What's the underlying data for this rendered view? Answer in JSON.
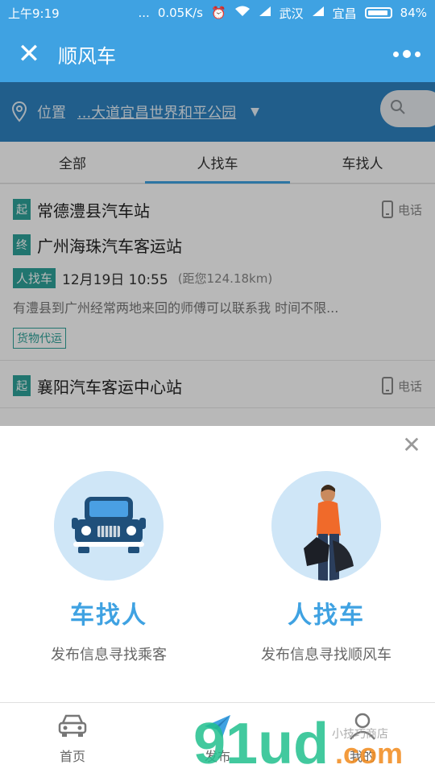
{
  "status_bar": {
    "time": "上午9:19",
    "dots": "...",
    "speed": "0.05K/s",
    "carrier1": "武汉",
    "carrier2": "宜昌",
    "battery": "84%"
  },
  "title_bar": {
    "title": "顺风车"
  },
  "location": {
    "label": "位置",
    "value": "...大道宜昌世界和平公园"
  },
  "tabs": [
    {
      "label": "全部",
      "active": false
    },
    {
      "label": "人找车",
      "active": true
    },
    {
      "label": "车找人",
      "active": false
    }
  ],
  "listings": [
    {
      "start_tag": "起",
      "start": "常德澧县汽车站",
      "end_tag": "终",
      "end": "广州海珠汽车客运站",
      "phone_label": "电话",
      "type_badge": "人找车",
      "time": "12月19日 10:55",
      "distance": "(距您124.18km)",
      "description": "有澧县到广州经常两地来回的师傅可以联系我 时间不限...",
      "tag": "货物代运"
    },
    {
      "start_tag": "起",
      "start": "襄阳汽车客运中心站",
      "phone_label": "电话"
    }
  ],
  "sheet": {
    "options": [
      {
        "title": "车找人",
        "subtitle": "发布信息寻找乘客"
      },
      {
        "title": "人找车",
        "subtitle": "发布信息寻找顺风车"
      }
    ]
  },
  "nav": [
    {
      "label": "首页"
    },
    {
      "label": "发布"
    },
    {
      "label": "我的"
    }
  ],
  "watermark": {
    "brand": "91ud.com",
    "tagline": "小技巧商店"
  },
  "colors": {
    "primary": "#3fa2e2",
    "dark_bar": "#2e83c1",
    "tag_green": "#2fa39a"
  }
}
